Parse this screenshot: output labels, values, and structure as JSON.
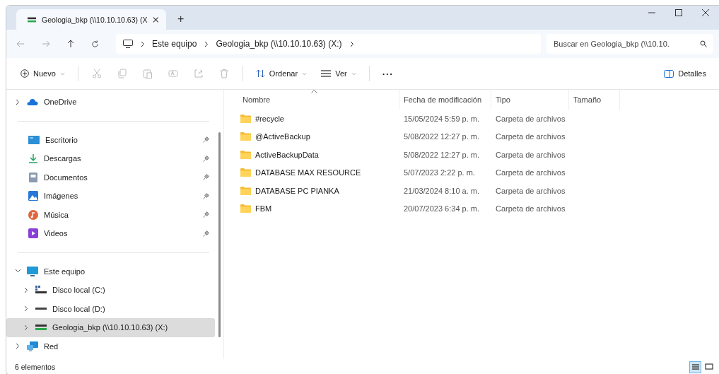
{
  "window": {
    "tab": {
      "title": "Geologia_bkp (\\\\10.10.10.63) (X",
      "selected": true
    },
    "new_tab": "+"
  },
  "nav": {
    "breadcrumbs": [
      "Este equipo",
      "Geologia_bkp (\\\\10.10.10.63) (X:)"
    ],
    "search": {
      "placeholder": "Buscar en Geologia_bkp (\\\\10.10."
    }
  },
  "toolbar": {
    "new": "Nuevo",
    "sort": "Ordenar",
    "view": "Ver",
    "more": "···",
    "details": "Detalles"
  },
  "sidebar": {
    "top": [
      {
        "label": "OneDrive",
        "kind": "cloud",
        "expanded": false,
        "selected": false
      }
    ],
    "pinned": [
      {
        "label": "Escritorio",
        "kind": "desktop",
        "selected": false
      },
      {
        "label": "Descargas",
        "kind": "download",
        "selected": false
      },
      {
        "label": "Documentos",
        "kind": "document",
        "selected": false
      },
      {
        "label": "Imágenes",
        "kind": "image",
        "selected": false
      },
      {
        "label": "Música",
        "kind": "music",
        "selected": false
      },
      {
        "label": "Videos",
        "kind": "video",
        "selected": false
      }
    ],
    "tree": [
      {
        "label": "Este equipo",
        "kind": "pc",
        "expanded": true,
        "selected": false,
        "children": [
          {
            "label": "Disco local (C:)",
            "kind": "sysdrive",
            "expanded": false,
            "selected": false
          },
          {
            "label": "Disco local (D:)",
            "kind": "drive",
            "expanded": false,
            "selected": false
          },
          {
            "label": "Geologia_bkp (\\\\10.10.10.63) (X:)",
            "kind": "netdrive",
            "expanded": false,
            "selected": true
          }
        ]
      },
      {
        "label": "Red",
        "kind": "network",
        "expanded": false,
        "selected": false
      }
    ]
  },
  "table": {
    "columns": [
      "Nombre",
      "Fecha de modificación",
      "Tipo",
      "Tamaño"
    ],
    "rows": [
      {
        "name": "#recycle",
        "date": "15/05/2024 5:59 p. m.",
        "type": "Carpeta de archivos"
      },
      {
        "name": "@ActiveBackup",
        "date": "5/08/2022 12:27 p. m.",
        "type": "Carpeta de archivos"
      },
      {
        "name": "ActiveBackupData",
        "date": "5/08/2022 12:27 p. m.",
        "type": "Carpeta de archivos"
      },
      {
        "name": "DATABASE MAX RESOURCE",
        "date": "5/07/2023 2:22 p. m.",
        "type": "Carpeta de archivos"
      },
      {
        "name": "DATABASE PC PIANKA",
        "date": "21/03/2024 8:10 a. m.",
        "type": "Carpeta de archivos"
      },
      {
        "name": "FBM",
        "date": "20/07/2023 6:34 p. m.",
        "type": "Carpeta de archivos"
      }
    ]
  },
  "status_bar": {
    "count": "6 elementos",
    "views": [
      {
        "kind": "details",
        "selected": true
      },
      {
        "kind": "tiles",
        "selected": false
      }
    ]
  }
}
